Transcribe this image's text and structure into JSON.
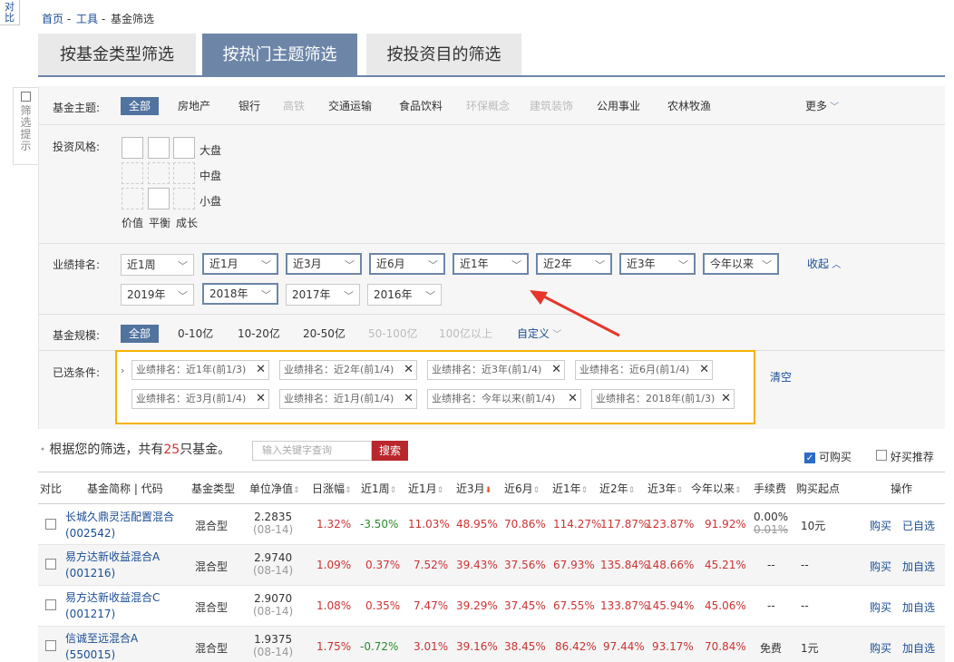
{
  "side_strip": {
    "label": "对比"
  },
  "breadcrumb": {
    "home": "首页",
    "sep": "-",
    "tools": "工具",
    "current": "基金筛选"
  },
  "tabs": [
    {
      "label": "按基金类型筛选"
    },
    {
      "label": "按热门主题筛选"
    },
    {
      "label": "按投资目的筛选"
    }
  ],
  "side_hint": {
    "label": "筛选提示"
  },
  "theme_row": {
    "label": "基金主题:",
    "options": [
      "全部",
      "房地产",
      "银行",
      "高铁",
      "交通运输",
      "食品饮料",
      "环保概念",
      "建筑装饰",
      "公用事业",
      "农林牧渔"
    ],
    "more": "更多"
  },
  "style_row": {
    "label": "投资风格:",
    "sizes": [
      "大盘",
      "中盘",
      "小盘"
    ],
    "styles": [
      "价值",
      "平衡",
      "成长"
    ]
  },
  "rank_row": {
    "label": "业绩排名:",
    "periods": [
      "近1周",
      "近1月",
      "近3月",
      "近6月",
      "近1年",
      "近2年",
      "近3年",
      "今年以来"
    ],
    "years": [
      "2019年",
      "2018年",
      "2017年",
      "2016年"
    ],
    "collapse": "收起"
  },
  "scale_row": {
    "label": "基金规模:",
    "options": [
      "全部",
      "0-10亿",
      "10-20亿",
      "20-50亿",
      "50-100亿",
      "100亿以上"
    ],
    "custom": "自定义"
  },
  "selected_row": {
    "label": "已选条件:",
    "tags": [
      "业绩排名：近1年(前1/3)",
      "业绩排名：近2年(前1/4)",
      "业绩排名：近3年(前1/4)",
      "业绩排名：近6月(前1/4)",
      "业绩排名：近3月(前1/4)",
      "业绩排名：近1月(前1/4)",
      "业绩排名：今年以来(前1/4)",
      "业绩排名：2018年(前1/3)"
    ],
    "clear": "清空"
  },
  "results": {
    "prefix": "根据您的筛选，共有",
    "count": "25",
    "suffix": "只基金。",
    "search_placeholder": "输入关键字查询",
    "search_button": "搜索",
    "can_buy": "可购买",
    "recommend": "好买推荐"
  },
  "table": {
    "headers": [
      "对比",
      "基金简称 | 代码",
      "基金类型",
      "单位净值",
      "日涨幅",
      "近1周",
      "近1月",
      "近3月",
      "近6月",
      "近1年",
      "近2年",
      "近3年",
      "今年以来",
      "手续费",
      "购买起点",
      "操作"
    ],
    "rows": [
      {
        "name": "长城久鼎灵活配置混合",
        "code": "(002542)",
        "type": "混合型",
        "nav": "2.2835",
        "date": "(08-14)",
        "day": "1.32%",
        "w1": "-3.50%",
        "m1": "11.03%",
        "m3": "48.95%",
        "m6": "70.86%",
        "y1": "114.27%",
        "y2": "117.87%",
        "y3": "123.87%",
        "ytd": "91.92%",
        "fee": "0.00%",
        "fee_old": "0.01%",
        "min": "10元",
        "buy": "购买",
        "watch": "已自选"
      },
      {
        "name": "易方达新收益混合A",
        "code": "(001216)",
        "type": "混合型",
        "nav": "2.9740",
        "date": "(08-14)",
        "day": "1.09%",
        "w1": "0.37%",
        "m1": "7.52%",
        "m3": "39.43%",
        "m6": "37.56%",
        "y1": "67.93%",
        "y2": "135.84%",
        "y3": "148.66%",
        "ytd": "45.21%",
        "fee": "--",
        "fee_old": "",
        "min": "--",
        "buy": "购买",
        "watch": "加自选"
      },
      {
        "name": "易方达新收益混合C",
        "code": "(001217)",
        "type": "混合型",
        "nav": "2.9070",
        "date": "(08-14)",
        "day": "1.08%",
        "w1": "0.35%",
        "m1": "7.47%",
        "m3": "39.29%",
        "m6": "37.45%",
        "y1": "67.55%",
        "y2": "133.87%",
        "y3": "145.94%",
        "ytd": "45.06%",
        "fee": "--",
        "fee_old": "",
        "min": "--",
        "buy": "购买",
        "watch": "加自选"
      },
      {
        "name": "信诚至远混合A",
        "code": "(550015)",
        "type": "混合型",
        "nav": "1.9375",
        "date": "(08-14)",
        "day": "1.75%",
        "w1": "-0.72%",
        "m1": "3.01%",
        "m3": "39.16%",
        "m6": "38.45%",
        "y1": "86.42%",
        "y2": "97.44%",
        "y3": "93.17%",
        "ytd": "70.84%",
        "fee": "免费",
        "fee_old": "",
        "min": "1元",
        "buy": "购买",
        "watch": "加自选"
      }
    ]
  },
  "colors": {
    "accent": "#6d86a8",
    "selected": "#51739f",
    "positive": "#cc3333",
    "negative": "#2a8a2a",
    "highlight_border": "#f5b300",
    "arrow": "#e8352b",
    "search_button": "#b8272c"
  }
}
